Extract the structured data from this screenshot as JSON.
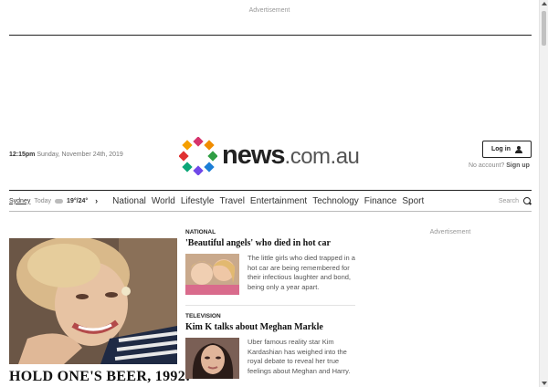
{
  "ads": {
    "top_label": "Advertisement",
    "side_label": "Advertisement"
  },
  "header": {
    "time": "12:15pm",
    "date": "Sunday, November 24th, 2019",
    "logo_main": "news",
    "logo_domain": ".com.au",
    "login_label": "Log in",
    "no_account": "No account?",
    "signup_label": "Sign up"
  },
  "weather": {
    "city": "Sydney",
    "day": "Today",
    "temps": "19°/24°",
    "icon": "cloud-icon"
  },
  "nav": {
    "items": [
      {
        "label": "National"
      },
      {
        "label": "World"
      },
      {
        "label": "Lifestyle"
      },
      {
        "label": "Travel"
      },
      {
        "label": "Entertainment"
      },
      {
        "label": "Technology"
      },
      {
        "label": "Finance"
      },
      {
        "label": "Sport"
      }
    ],
    "search_label": "Search"
  },
  "hero": {
    "headline": "HOLD ONE'S BEER, 1992:"
  },
  "stories": [
    {
      "category": "NATIONAL",
      "title": "'Beautiful angels' who died in hot car",
      "description": "The little girls who died trapped in a hot car are being remembered for their infectious laughter and bond, being only a year apart."
    },
    {
      "category": "TELEVISION",
      "title": "Kim K talks about Meghan Markle",
      "description": "Uber famous reality star Kim Kardashian has weighed into the royal debate to reveal her true feelings about Meghan and Harry."
    }
  ],
  "colors": {
    "accent": "#222222",
    "logo_dots": [
      "#d6336c",
      "#f08c00",
      "#2f9e44",
      "#1c7ed6",
      "#7048e8",
      "#e03131",
      "#0ca678",
      "#f59f00"
    ]
  }
}
